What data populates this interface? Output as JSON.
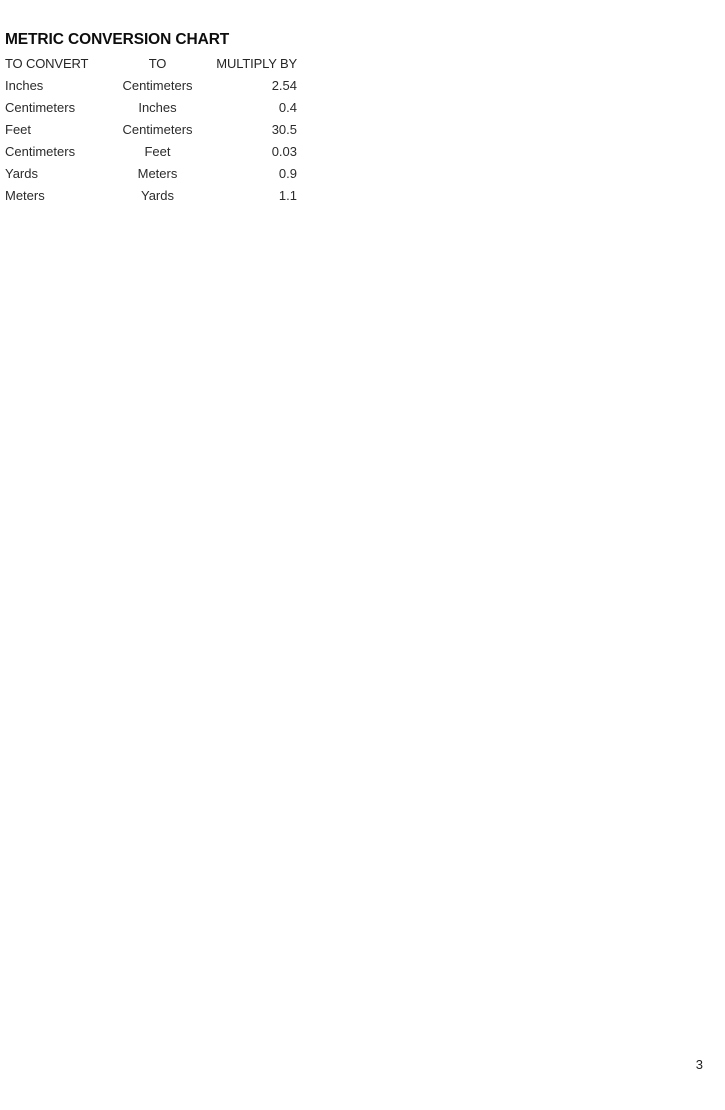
{
  "document": {
    "page_number": "3",
    "background_color": "#ffffff",
    "text_color": "#2b2b2b"
  },
  "chart": {
    "title": "METRIC CONVERSION CHART",
    "columns": [
      {
        "key": "from",
        "label": "TO CONVERT",
        "align": "left"
      },
      {
        "key": "to",
        "label": "TO",
        "align": "center"
      },
      {
        "key": "multiplier",
        "label": "MULTIPLY BY",
        "align": "right"
      }
    ],
    "rows": [
      {
        "from": "Inches",
        "to": "Centimeters",
        "multiplier": "2.54"
      },
      {
        "from": "Centimeters",
        "to": "Inches",
        "multiplier": "0.4"
      },
      {
        "from": "Feet",
        "to": "Centimeters",
        "multiplier": "30.5"
      },
      {
        "from": "Centimeters",
        "to": "Feet",
        "multiplier": "0.03"
      },
      {
        "from": "Yards",
        "to": "Meters",
        "multiplier": "0.9"
      },
      {
        "from": "Meters",
        "to": "Yards",
        "multiplier": "1.1"
      }
    ]
  }
}
